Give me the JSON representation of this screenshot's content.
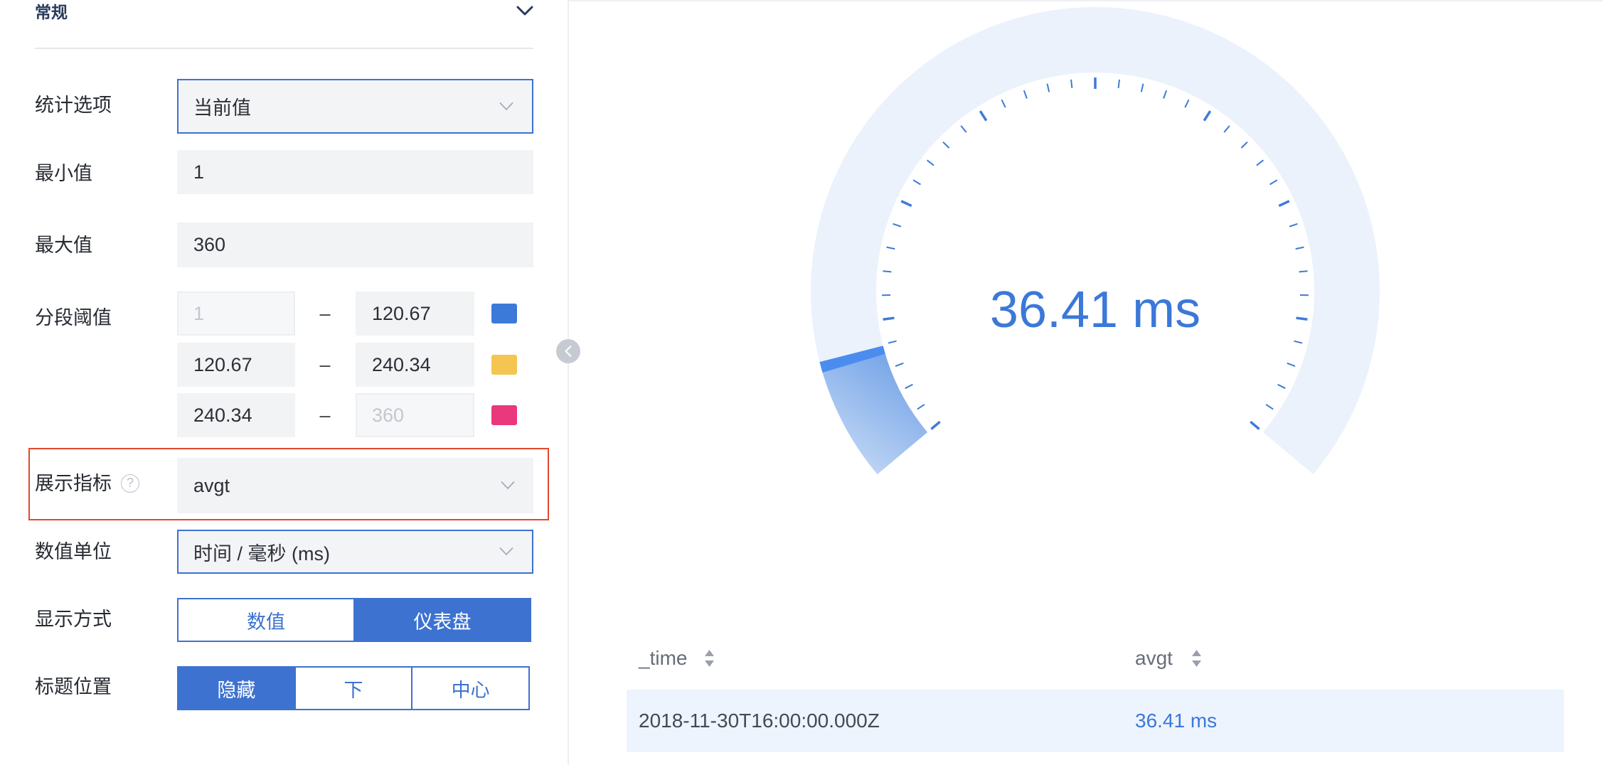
{
  "section": {
    "title": "常规"
  },
  "form": {
    "stat_option": {
      "label": "统计选项",
      "value": "当前值"
    },
    "min": {
      "label": "最小值",
      "value": "1"
    },
    "max": {
      "label": "最大值",
      "value": "360"
    },
    "thresholds": {
      "label": "分段阈值",
      "separator": "–",
      "rows": [
        {
          "from": "1",
          "to": "120.67",
          "color": "#3b7ad8"
        },
        {
          "from": "120.67",
          "to": "240.34",
          "color": "#f5c551"
        },
        {
          "from": "240.34",
          "to": "360",
          "color": "#e9387b"
        }
      ]
    },
    "display_metric": {
      "label": "展示指标",
      "value": "avgt"
    },
    "unit": {
      "label": "数值单位",
      "value": "时间 / 毫秒 (ms)"
    },
    "display_mode": {
      "label": "显示方式",
      "options": [
        "数值",
        "仪表盘"
      ],
      "selected": "仪表盘"
    },
    "title_position": {
      "label": "标题位置",
      "options": [
        "隐藏",
        "下",
        "中心"
      ],
      "selected": "隐藏"
    }
  },
  "gauge": {
    "value": 36.41,
    "min": 1,
    "max": 360,
    "display": "36.41 ms"
  },
  "table": {
    "columns": [
      "_time",
      "avgt"
    ],
    "rows": [
      [
        "2018-11-30T16:00:00.000Z",
        "36.41 ms"
      ]
    ]
  },
  "colors": {
    "accent": "#3d72d1",
    "gauge_text": "#3b78d8",
    "gauge_track": "#ebf2fc",
    "gauge_fill_light": "#c9dcf6",
    "gauge_fill": "#6b9ee6",
    "gauge_edge": "#4b8cef",
    "gauge_tick": "#3e7ad8",
    "highlight": "#e0492c",
    "table_row_bg": "#eef4fd"
  },
  "icons": {
    "section_toggle": "chevron-down-icon",
    "select_arrow": "chevron-down-icon",
    "help": "help-circle-icon",
    "sort": "sort-icon",
    "collapse": "chevron-left-icon"
  }
}
